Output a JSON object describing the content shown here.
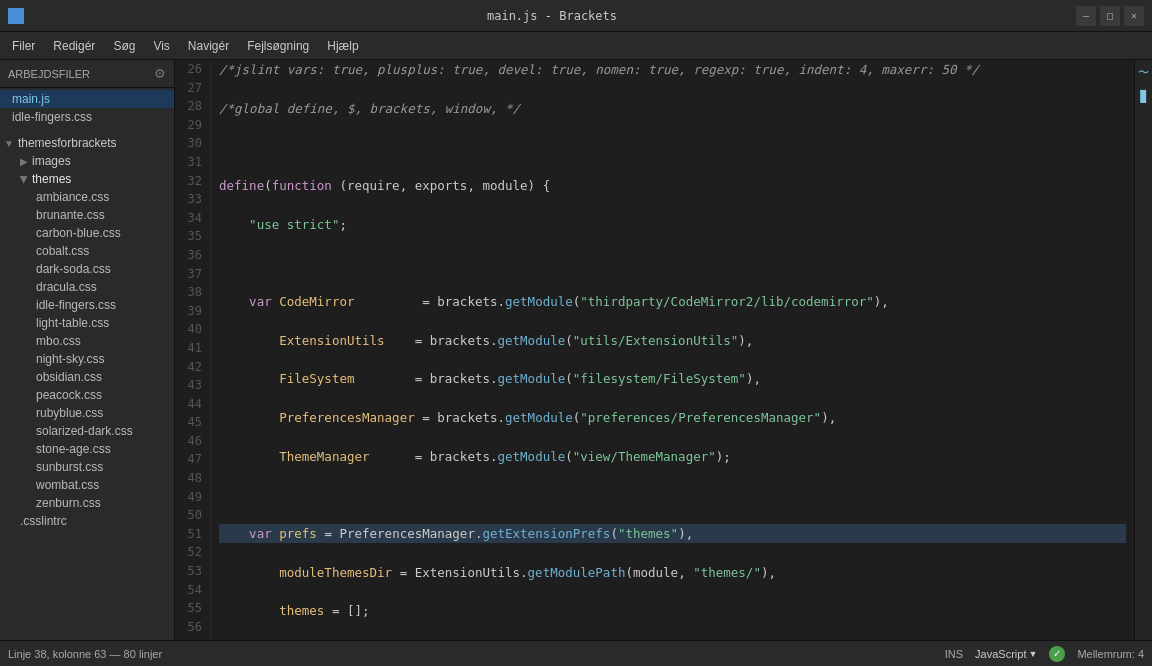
{
  "titleBar": {
    "title": "main.js - Brackets",
    "minimize": "—",
    "maximize": "□",
    "close": "✕"
  },
  "menuBar": {
    "items": [
      "Filer",
      "Redigér",
      "Søg",
      "Vis",
      "Navigér",
      "Fejlsøgning",
      "Hjælp"
    ]
  },
  "sidebar": {
    "header": "Arbejdsfiler",
    "files": [
      {
        "name": "main.js",
        "active": true,
        "type": "file"
      },
      {
        "name": "idle-fingers.css",
        "active": false,
        "type": "file"
      }
    ],
    "project": "themesforbrackets",
    "folders": [
      {
        "name": "images",
        "indent": 1,
        "open": false,
        "type": "folder"
      },
      {
        "name": "themes",
        "indent": 1,
        "open": true,
        "type": "folder"
      },
      {
        "name": "ambiance.css",
        "indent": 2,
        "type": "file"
      },
      {
        "name": "brunante.css",
        "indent": 2,
        "type": "file"
      },
      {
        "name": "carbon-blue.css",
        "indent": 2,
        "type": "file"
      },
      {
        "name": "cobalt.css",
        "indent": 2,
        "type": "file"
      },
      {
        "name": "dark-soda.css",
        "indent": 2,
        "type": "file"
      },
      {
        "name": "dracula.css",
        "indent": 2,
        "type": "file"
      },
      {
        "name": "idle-fingers.css",
        "indent": 2,
        "type": "file"
      },
      {
        "name": "light-table.css",
        "indent": 2,
        "type": "file"
      },
      {
        "name": "mbo.css",
        "indent": 2,
        "type": "file"
      },
      {
        "name": "night-sky.css",
        "indent": 2,
        "type": "file"
      },
      {
        "name": "obsidian.css",
        "indent": 2,
        "type": "file"
      },
      {
        "name": "peacock.css",
        "indent": 2,
        "type": "file"
      },
      {
        "name": "rubyblue.css",
        "indent": 2,
        "type": "file"
      },
      {
        "name": "solarized-dark.css",
        "indent": 2,
        "type": "file"
      },
      {
        "name": "stone-age.css",
        "indent": 2,
        "type": "file"
      },
      {
        "name": "sunburst.css",
        "indent": 2,
        "type": "file"
      },
      {
        "name": "wombat.css",
        "indent": 2,
        "type": "file"
      },
      {
        "name": "zenburn.css",
        "indent": 2,
        "type": "file"
      }
    ],
    "bottomFile": ".csslintrc"
  },
  "statusBar": {
    "position": "Linje 38, kolonne 63",
    "lines": "80 linjer",
    "mode": "INS",
    "language": "JavaScript",
    "indent": "Mellemrum: 4"
  },
  "rightSidebar": {
    "icons": [
      "~",
      "📊"
    ]
  }
}
